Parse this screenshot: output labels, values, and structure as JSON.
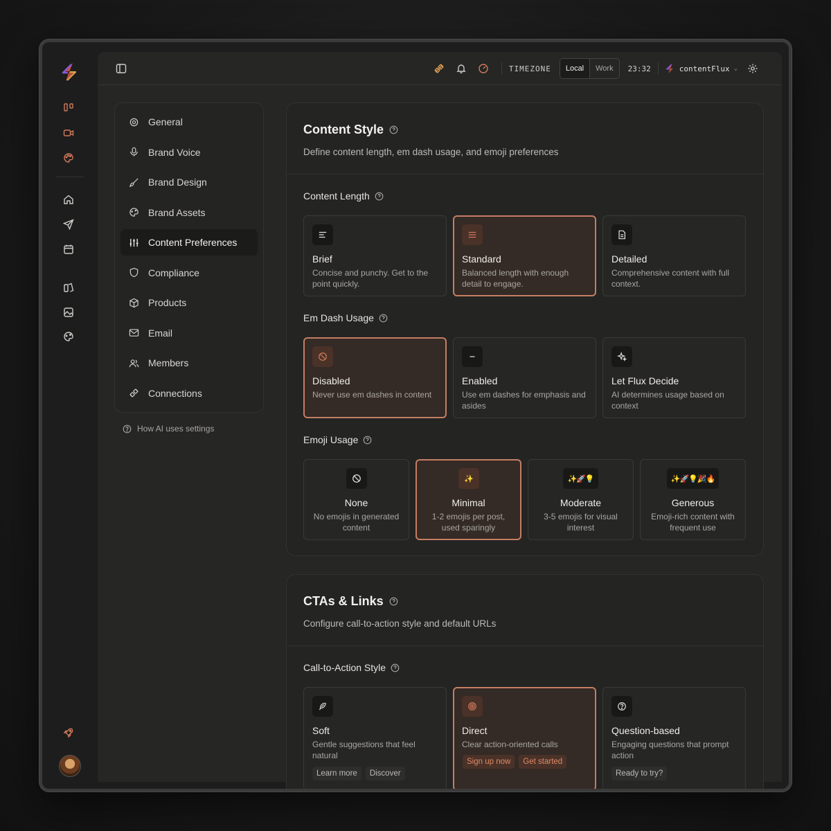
{
  "topbar": {
    "timezone_label": "TIMEZONE",
    "tz_options": [
      "Local",
      "Work"
    ],
    "tz_selected": "Local",
    "clock": "23:32",
    "workspace": "contentFlux"
  },
  "settings_nav": {
    "items": [
      {
        "label": "General",
        "icon": "gear-icon"
      },
      {
        "label": "Brand Voice",
        "icon": "microphone-icon"
      },
      {
        "label": "Brand Design",
        "icon": "brush-icon"
      },
      {
        "label": "Brand Assets",
        "icon": "palette-icon"
      },
      {
        "label": "Content Preferences",
        "icon": "sliders-icon",
        "active": true
      },
      {
        "label": "Compliance",
        "icon": "shield-icon"
      },
      {
        "label": "Products",
        "icon": "box-icon"
      },
      {
        "label": "Email",
        "icon": "mail-icon"
      },
      {
        "label": "Members",
        "icon": "users-icon"
      },
      {
        "label": "Connections",
        "icon": "plug-icon"
      }
    ],
    "help_link": "How AI uses settings"
  },
  "content_style": {
    "title": "Content Style",
    "subtitle": "Define content length, em dash usage, and emoji preferences",
    "length": {
      "label": "Content Length",
      "options": [
        {
          "title": "Brief",
          "desc": "Concise and punchy. Get to the point quickly."
        },
        {
          "title": "Standard",
          "desc": "Balanced length with enough detail to engage.",
          "selected": true
        },
        {
          "title": "Detailed",
          "desc": "Comprehensive content with full context."
        }
      ]
    },
    "emdash": {
      "label": "Em Dash Usage",
      "options": [
        {
          "title": "Disabled",
          "desc": "Never use em dashes in content",
          "selected": true
        },
        {
          "title": "Enabled",
          "desc": "Use em dashes for emphasis and asides"
        },
        {
          "title": "Let Flux Decide",
          "desc": "AI determines usage based on context"
        }
      ]
    },
    "emoji": {
      "label": "Emoji Usage",
      "options": [
        {
          "title": "None",
          "desc": "No emojis in generated content",
          "glyph": ""
        },
        {
          "title": "Minimal",
          "desc": "1-2 emojis per post, used sparingly",
          "glyph": "✨",
          "selected": true
        },
        {
          "title": "Moderate",
          "desc": "3-5 emojis for visual interest",
          "glyph": "✨🚀💡"
        },
        {
          "title": "Generous",
          "desc": "Emoji-rich content with frequent use",
          "glyph": "✨🚀💡🎉🔥"
        }
      ]
    }
  },
  "ctas": {
    "title": "CTAs & Links",
    "subtitle": "Configure call-to-action style and default URLs",
    "style": {
      "label": "Call-to-Action Style",
      "options": [
        {
          "title": "Soft",
          "desc": "Gentle suggestions that feel natural",
          "examples": [
            "Learn more",
            "Discover"
          ]
        },
        {
          "title": "Direct",
          "desc": "Clear action-oriented calls",
          "examples": [
            "Sign up now",
            "Get started"
          ],
          "selected": true
        },
        {
          "title": "Question-based",
          "desc": "Engaging questions that prompt action",
          "examples": [
            "Ready to try?"
          ]
        }
      ]
    }
  },
  "colors": {
    "accent": "#c57e63",
    "accent_bg": "#342a26",
    "background": "#262625"
  }
}
